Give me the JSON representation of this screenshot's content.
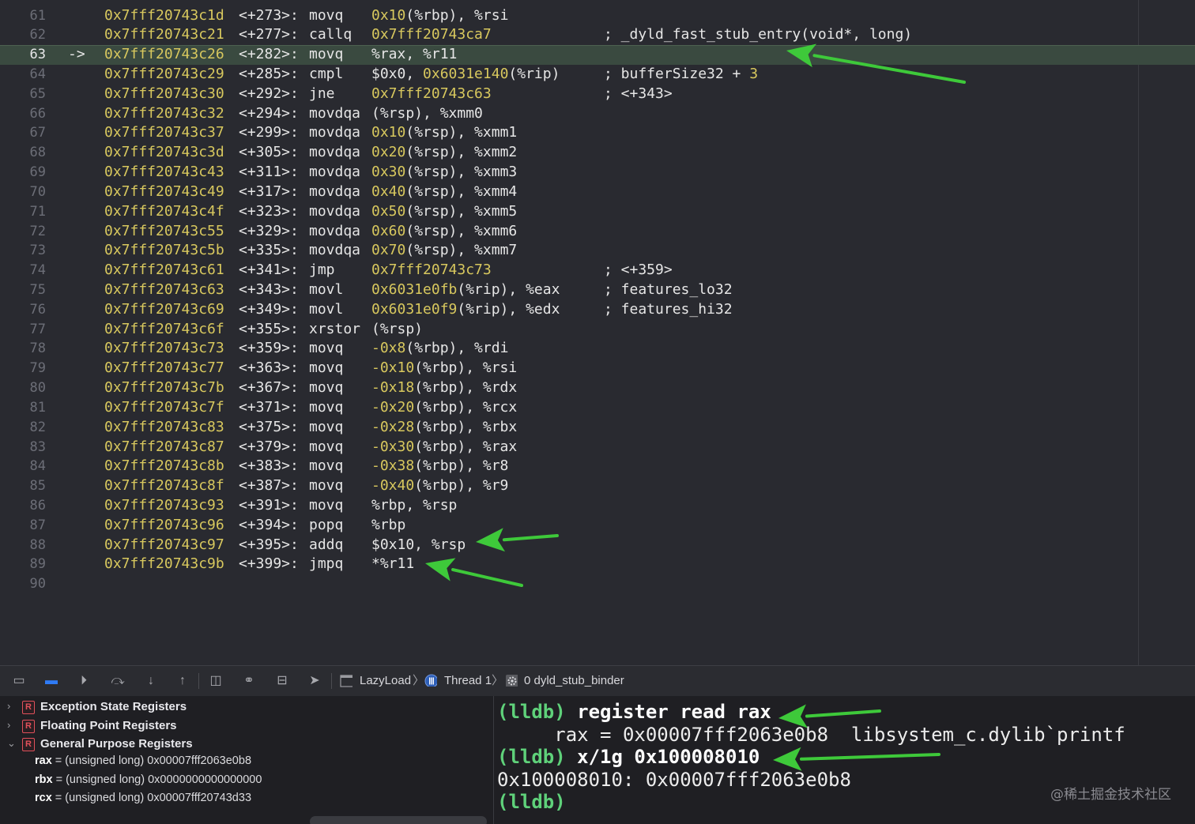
{
  "editor": {
    "current_line": "63",
    "pc_arrow": "->",
    "rows": [
      {
        "n": "61",
        "addr": "0x7fff20743c1d",
        "off": "<+273>:",
        "mn": "movq",
        "ops": [
          {
            "t": "0x10",
            "num": true
          },
          {
            "t": "(%rbp), %rsi"
          }
        ],
        "cmt": []
      },
      {
        "n": "62",
        "addr": "0x7fff20743c21",
        "off": "<+277>:",
        "mn": "callq",
        "ops": [
          {
            "t": "0x7fff20743ca7",
            "num": true
          }
        ],
        "cmt": [
          {
            "t": "; _dyld_fast_stub_entry(void*, long)"
          }
        ]
      },
      {
        "n": "63",
        "addr": "0x7fff20743c26",
        "off": "<+282>:",
        "mn": "movq",
        "ops": [
          {
            "t": "%rax, %r11"
          }
        ],
        "cmt": []
      },
      {
        "n": "64",
        "addr": "0x7fff20743c29",
        "off": "<+285>:",
        "mn": "cmpl",
        "ops": [
          {
            "t": "$0x0, "
          },
          {
            "t": "0x6031e140",
            "num": true
          },
          {
            "t": "(%rip)"
          }
        ],
        "cmt": [
          {
            "t": "; bufferSize32 + "
          },
          {
            "t": "3",
            "num": true
          }
        ]
      },
      {
        "n": "65",
        "addr": "0x7fff20743c30",
        "off": "<+292>:",
        "mn": "jne",
        "ops": [
          {
            "t": "0x7fff20743c63",
            "num": true
          }
        ],
        "cmt": [
          {
            "t": "; <+343>"
          }
        ]
      },
      {
        "n": "66",
        "addr": "0x7fff20743c32",
        "off": "<+294>:",
        "mn": "movdqa",
        "ops": [
          {
            "t": "(%rsp), %xmm0"
          }
        ],
        "cmt": []
      },
      {
        "n": "67",
        "addr": "0x7fff20743c37",
        "off": "<+299>:",
        "mn": "movdqa",
        "ops": [
          {
            "t": "0x10",
            "num": true
          },
          {
            "t": "(%rsp), %xmm1"
          }
        ],
        "cmt": []
      },
      {
        "n": "68",
        "addr": "0x7fff20743c3d",
        "off": "<+305>:",
        "mn": "movdqa",
        "ops": [
          {
            "t": "0x20",
            "num": true
          },
          {
            "t": "(%rsp), %xmm2"
          }
        ],
        "cmt": []
      },
      {
        "n": "69",
        "addr": "0x7fff20743c43",
        "off": "<+311>:",
        "mn": "movdqa",
        "ops": [
          {
            "t": "0x30",
            "num": true
          },
          {
            "t": "(%rsp), %xmm3"
          }
        ],
        "cmt": []
      },
      {
        "n": "70",
        "addr": "0x7fff20743c49",
        "off": "<+317>:",
        "mn": "movdqa",
        "ops": [
          {
            "t": "0x40",
            "num": true
          },
          {
            "t": "(%rsp), %xmm4"
          }
        ],
        "cmt": []
      },
      {
        "n": "71",
        "addr": "0x7fff20743c4f",
        "off": "<+323>:",
        "mn": "movdqa",
        "ops": [
          {
            "t": "0x50",
            "num": true
          },
          {
            "t": "(%rsp), %xmm5"
          }
        ],
        "cmt": []
      },
      {
        "n": "72",
        "addr": "0x7fff20743c55",
        "off": "<+329>:",
        "mn": "movdqa",
        "ops": [
          {
            "t": "0x60",
            "num": true
          },
          {
            "t": "(%rsp), %xmm6"
          }
        ],
        "cmt": []
      },
      {
        "n": "73",
        "addr": "0x7fff20743c5b",
        "off": "<+335>:",
        "mn": "movdqa",
        "ops": [
          {
            "t": "0x70",
            "num": true
          },
          {
            "t": "(%rsp), %xmm7"
          }
        ],
        "cmt": []
      },
      {
        "n": "74",
        "addr": "0x7fff20743c61",
        "off": "<+341>:",
        "mn": "jmp",
        "ops": [
          {
            "t": "0x7fff20743c73",
            "num": true
          }
        ],
        "cmt": [
          {
            "t": "; <+359>"
          }
        ]
      },
      {
        "n": "75",
        "addr": "0x7fff20743c63",
        "off": "<+343>:",
        "mn": "movl",
        "ops": [
          {
            "t": "0x6031e0fb",
            "num": true
          },
          {
            "t": "(%rip), %eax"
          }
        ],
        "cmt": [
          {
            "t": "; features_lo32"
          }
        ]
      },
      {
        "n": "76",
        "addr": "0x7fff20743c69",
        "off": "<+349>:",
        "mn": "movl",
        "ops": [
          {
            "t": "0x6031e0f9",
            "num": true
          },
          {
            "t": "(%rip), %edx"
          }
        ],
        "cmt": [
          {
            "t": "; features_hi32"
          }
        ]
      },
      {
        "n": "77",
        "addr": "0x7fff20743c6f",
        "off": "<+355>:",
        "mn": "xrstor",
        "ops": [
          {
            "t": "(%rsp)"
          }
        ],
        "cmt": []
      },
      {
        "n": "78",
        "addr": "0x7fff20743c73",
        "off": "<+359>:",
        "mn": "movq",
        "ops": [
          {
            "t": "-0x8",
            "num": true
          },
          {
            "t": "(%rbp), %rdi"
          }
        ],
        "cmt": []
      },
      {
        "n": "79",
        "addr": "0x7fff20743c77",
        "off": "<+363>:",
        "mn": "movq",
        "ops": [
          {
            "t": "-0x10",
            "num": true
          },
          {
            "t": "(%rbp), %rsi"
          }
        ],
        "cmt": []
      },
      {
        "n": "80",
        "addr": "0x7fff20743c7b",
        "off": "<+367>:",
        "mn": "movq",
        "ops": [
          {
            "t": "-0x18",
            "num": true
          },
          {
            "t": "(%rbp), %rdx"
          }
        ],
        "cmt": []
      },
      {
        "n": "81",
        "addr": "0x7fff20743c7f",
        "off": "<+371>:",
        "mn": "movq",
        "ops": [
          {
            "t": "-0x20",
            "num": true
          },
          {
            "t": "(%rbp), %rcx"
          }
        ],
        "cmt": []
      },
      {
        "n": "82",
        "addr": "0x7fff20743c83",
        "off": "<+375>:",
        "mn": "movq",
        "ops": [
          {
            "t": "-0x28",
            "num": true
          },
          {
            "t": "(%rbp), %rbx"
          }
        ],
        "cmt": []
      },
      {
        "n": "83",
        "addr": "0x7fff20743c87",
        "off": "<+379>:",
        "mn": "movq",
        "ops": [
          {
            "t": "-0x30",
            "num": true
          },
          {
            "t": "(%rbp), %rax"
          }
        ],
        "cmt": []
      },
      {
        "n": "84",
        "addr": "0x7fff20743c8b",
        "off": "<+383>:",
        "mn": "movq",
        "ops": [
          {
            "t": "-0x38",
            "num": true
          },
          {
            "t": "(%rbp), %r8"
          }
        ],
        "cmt": []
      },
      {
        "n": "85",
        "addr": "0x7fff20743c8f",
        "off": "<+387>:",
        "mn": "movq",
        "ops": [
          {
            "t": "-0x40",
            "num": true
          },
          {
            "t": "(%rbp), %r9"
          }
        ],
        "cmt": []
      },
      {
        "n": "86",
        "addr": "0x7fff20743c93",
        "off": "<+391>:",
        "mn": "movq",
        "ops": [
          {
            "t": "%rbp, %rsp"
          }
        ],
        "cmt": []
      },
      {
        "n": "87",
        "addr": "0x7fff20743c96",
        "off": "<+394>:",
        "mn": "popq",
        "ops": [
          {
            "t": "%rbp"
          }
        ],
        "cmt": []
      },
      {
        "n": "88",
        "addr": "0x7fff20743c97",
        "off": "<+395>:",
        "mn": "addq",
        "ops": [
          {
            "t": "$0x10, %rsp"
          }
        ],
        "cmt": []
      },
      {
        "n": "89",
        "addr": "0x7fff20743c9b",
        "off": "<+399>:",
        "mn": "jmpq",
        "ops": [
          {
            "t": "*%r11"
          }
        ],
        "cmt": []
      },
      {
        "n": "90",
        "addr": "",
        "off": "",
        "mn": "",
        "ops": [],
        "cmt": []
      }
    ]
  },
  "toolbar": {
    "buttons": [
      {
        "name": "hide-debug-area-icon",
        "glyph": "▭"
      },
      {
        "name": "breakpoints-toggle-icon",
        "glyph": "▬"
      },
      {
        "name": "continue-icon",
        "glyph": "⏵"
      },
      {
        "name": "step-over-icon",
        "glyph": "⤼"
      },
      {
        "name": "step-into-icon",
        "glyph": "↓"
      },
      {
        "name": "step-out-icon",
        "glyph": "↑"
      },
      {
        "name": "view-hierarchy-icon",
        "glyph": "◫"
      },
      {
        "name": "memory-graph-icon",
        "glyph": "⚭"
      },
      {
        "name": "environment-overrides-icon",
        "glyph": "⊟"
      },
      {
        "name": "simulate-location-icon",
        "glyph": "➤"
      }
    ],
    "breadcrumb": {
      "target": "LazyLoad",
      "thread": "Thread 1",
      "frame": "0 dyld_stub_binder"
    }
  },
  "variables": {
    "groups": [
      {
        "label": "Exception State Registers",
        "expanded": false,
        "badge": "R"
      },
      {
        "label": "Floating Point Registers",
        "expanded": false,
        "badge": "R"
      },
      {
        "label": "General Purpose Registers",
        "expanded": true,
        "badge": "R"
      }
    ],
    "registers": [
      {
        "name": "rax",
        "value": " = (unsigned long) 0x00007fff2063e0b8"
      },
      {
        "name": "rbx",
        "value": " = (unsigned long) 0x0000000000000000"
      },
      {
        "name": "rcx",
        "value": " = (unsigned long) 0x00007fff20743d33"
      }
    ]
  },
  "console": {
    "prompt": "(lldb)",
    "cmd1": "register read rax",
    "out1": "     rax = 0x00007fff2063e0b8  libsystem_c.dylib`printf",
    "cmd2": "x/1g 0x100008010",
    "out2": "0x100008010: 0x00007fff2063e0b8",
    "watermark": "@稀土掘金技术社区"
  },
  "colors": {
    "annotation_arrow": "#3ec93a",
    "address_yellow": "#d8c85e",
    "current_line_bg": "#3a4a40",
    "prompt_green": "#5fd17a"
  }
}
